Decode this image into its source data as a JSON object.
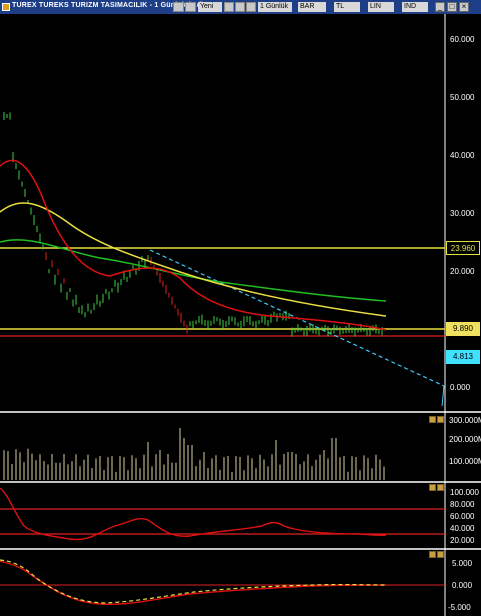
{
  "window": {
    "title": "TUREX TUREKS TURIZM TASIMACILIK - 1 Günlük (.1d)",
    "toolbar_field": "Yeni",
    "period": "1 Günlük",
    "chart_type": "BAR",
    "currency": "TL",
    "scale": "LIN",
    "indicator": "IND"
  },
  "price_pane": {
    "axis_labels": [
      "60.000",
      "50.000",
      "40.000",
      "30.000",
      "20.000",
      "0.000"
    ],
    "h_level_1": "23.960",
    "h_level_2": "9.890",
    "last_value": "4.813",
    "colors": {
      "ma_short": "#e01010",
      "ma_mid": "#e8e040",
      "ma_long": "#20c020",
      "bars": "#40d040",
      "down_bars": "#e02020",
      "trendline": "#40c8ff",
      "level": "#e8e040",
      "last_tag": "#40e0ff"
    }
  },
  "volume_pane": {
    "axis_labels": [
      "300.000M",
      "200.000M",
      "100.000M"
    ]
  },
  "osc1_pane": {
    "axis_labels": [
      "100.000",
      "80.000",
      "60.000",
      "40.000",
      "20.000"
    ]
  },
  "osc2_pane": {
    "axis_labels": [
      "5.000",
      "0.000",
      "-5.000"
    ]
  }
}
